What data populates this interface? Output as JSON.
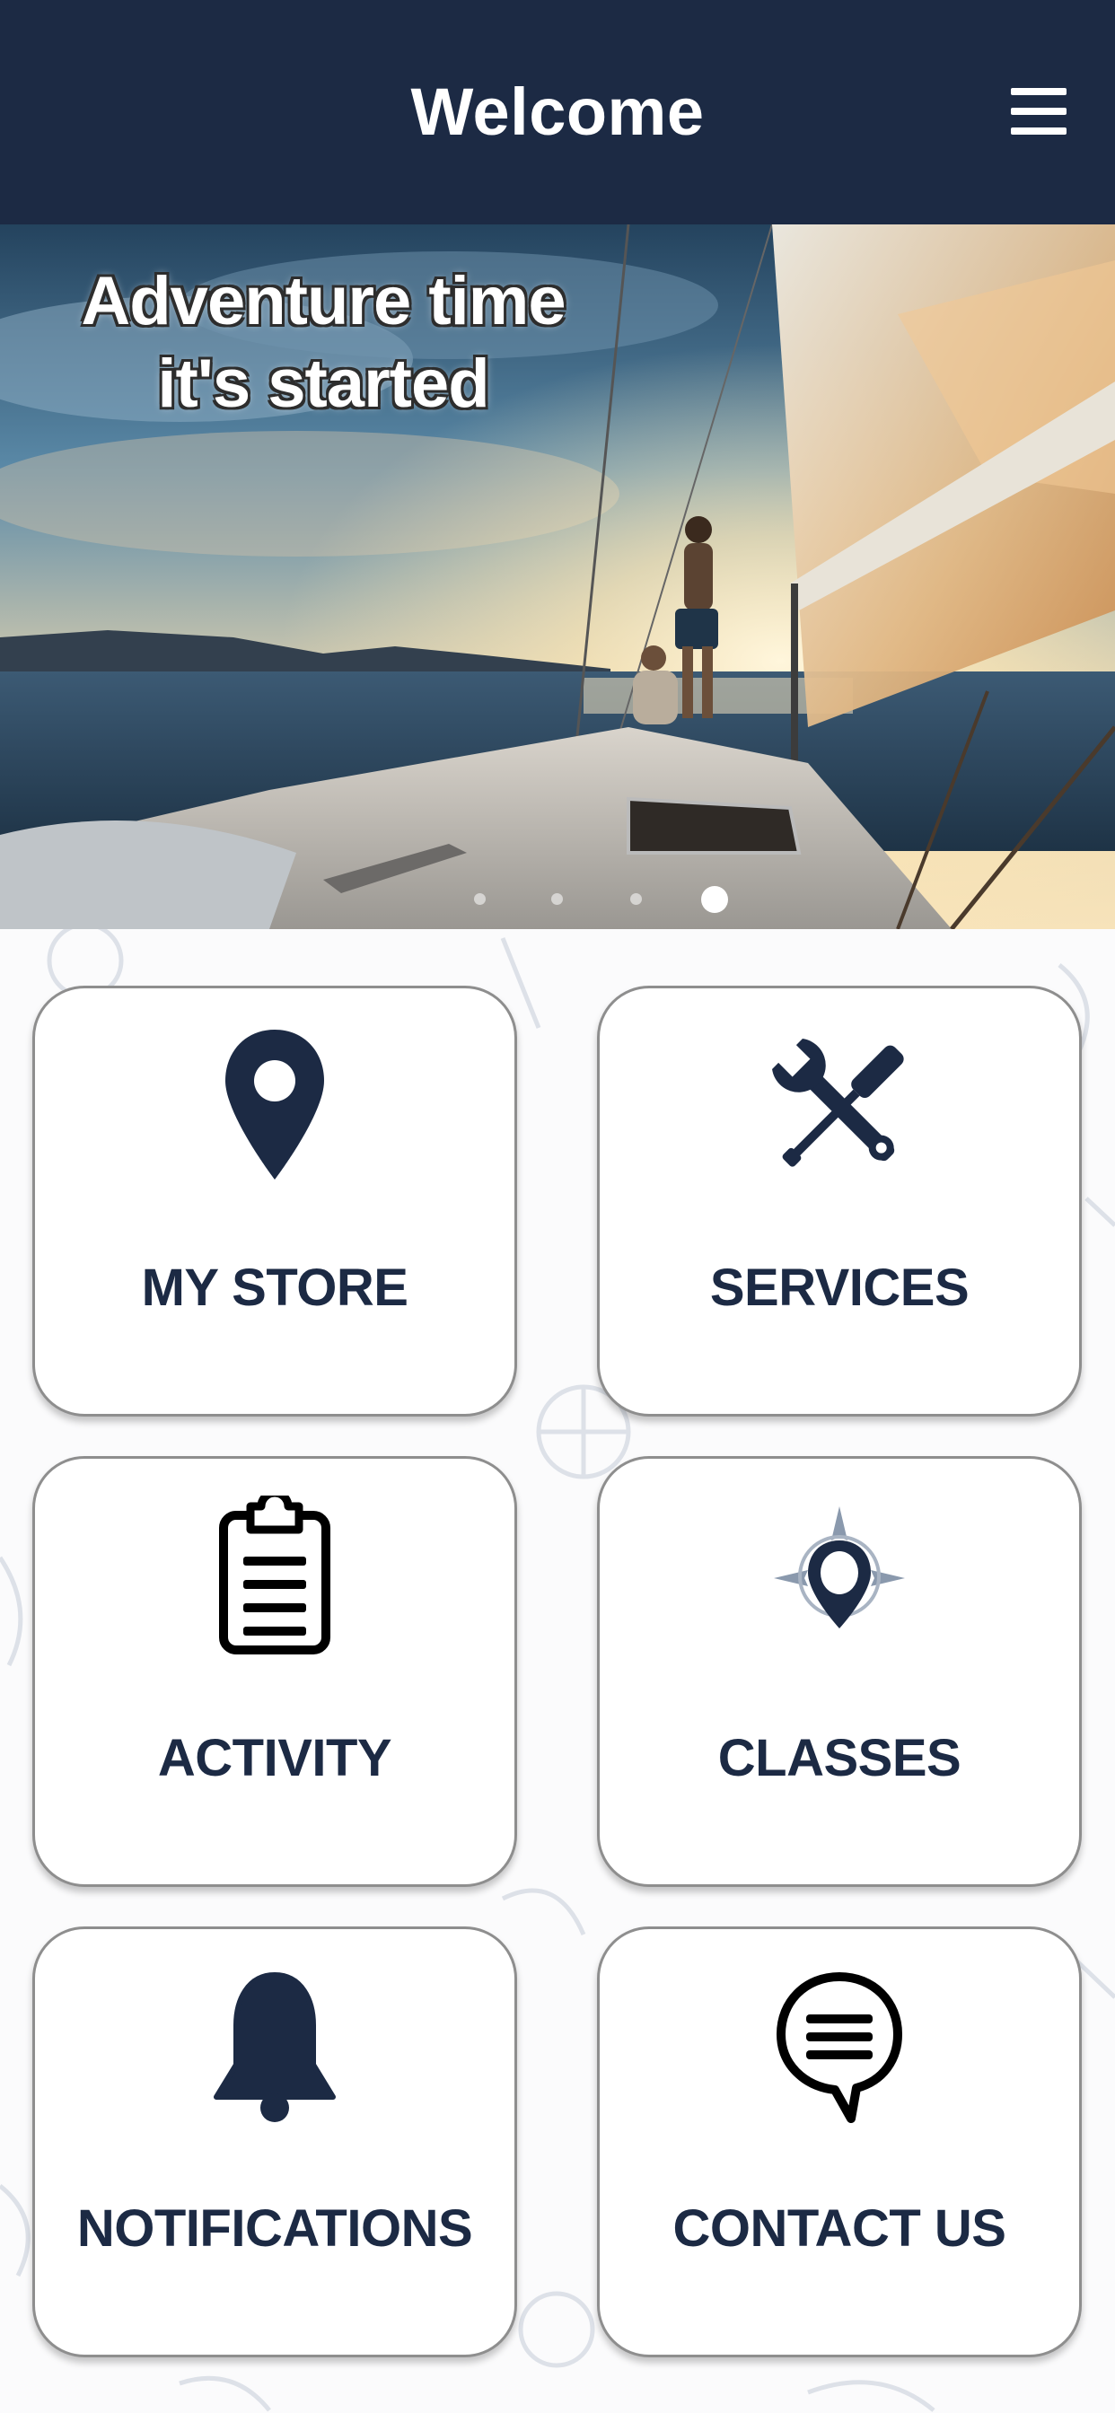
{
  "header": {
    "title": "Welcome",
    "menu_icon": "hamburger-menu-icon"
  },
  "banner": {
    "headline_line1": "Adventure time",
    "headline_line2": "it's started",
    "slide_count": 4,
    "active_slide": 4
  },
  "tiles": [
    {
      "label": "MY STORE",
      "icon": "map-pin-icon"
    },
    {
      "label": "SERVICES",
      "icon": "wrench-screwdriver-icon"
    },
    {
      "label": "ACTIVITY",
      "icon": "clipboard-list-icon"
    },
    {
      "label": "CLASSES",
      "icon": "compass-pin-icon"
    },
    {
      "label": "NOTIFICATIONS",
      "icon": "bell-icon"
    },
    {
      "label": "CONTACT US",
      "icon": "chat-bubble-icon"
    }
  ],
  "colors": {
    "primary_navy": "#1c2a44",
    "tile_border": "#8e8e8e",
    "background": "#fbfbfc"
  }
}
